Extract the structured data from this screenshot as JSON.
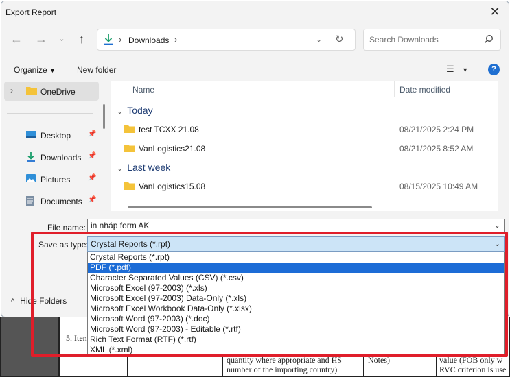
{
  "dialog": {
    "title": "Export Report",
    "close_icon": "close-icon"
  },
  "nav": {
    "back_icon": "arrow-left-icon",
    "forward_icon": "arrow-right-icon",
    "recent_icon": "chevron-down-icon",
    "up_icon": "arrow-up-icon",
    "address": {
      "crumb": "Downloads"
    },
    "search_placeholder": "Search Downloads"
  },
  "toolbar": {
    "organize": "Organize",
    "new_folder": "New folder"
  },
  "sidebar": {
    "items": [
      {
        "label": "OneDrive"
      },
      {
        "label": "Desktop"
      },
      {
        "label": "Downloads"
      },
      {
        "label": "Pictures"
      },
      {
        "label": "Documents"
      }
    ]
  },
  "files": {
    "columns": {
      "name": "Name",
      "date": "Date modified"
    },
    "groups": [
      {
        "label": "Today"
      },
      {
        "label": "Last week"
      }
    ],
    "rows": [
      {
        "name": "test TCXX 21.08",
        "date": "08/21/2025 2:24 PM"
      },
      {
        "name": "VanLogistics21.08",
        "date": "08/21/2025 8:52 AM"
      },
      {
        "name": "VanLogistics15.08",
        "date": "08/15/2025 10:49 AM"
      }
    ]
  },
  "form": {
    "file_name_label": "File name:",
    "file_name_value": "in nháp form AK",
    "save_as_type_label": "Save as type:",
    "save_as_type_value": "Crystal Reports (*.rpt)",
    "options": [
      "Crystal Reports (*.rpt)",
      "PDF (*.pdf)",
      "Character Separated Values (CSV) (*.csv)",
      "Microsoft Excel (97-2003) (*.xls)",
      "Microsoft Excel (97-2003) Data-Only (*.xls)",
      "Microsoft Excel Workbook Data-Only (*.xlsx)",
      "Microsoft Word (97-2003) (*.doc)",
      "Microsoft Word (97-2003) - Editable (*.rtf)",
      "Rich Text Format (RTF) (*.rtf)",
      "XML (*.xml)"
    ],
    "highlighted_index": 1,
    "hide_folders": "Hide Folders"
  },
  "background": {
    "item_label": "5. Iten",
    "text_line1": "quantity where appropriate and HS",
    "text_line2": "number of the importing country)",
    "text_mid": "Notes)",
    "text_right1": "value (FOB only w",
    "text_right2": "RVC criterion is use"
  },
  "colors": {
    "accent": "#1c6cd6",
    "highlight_box": "#e01e2a",
    "select_bg": "#cce4f7"
  }
}
